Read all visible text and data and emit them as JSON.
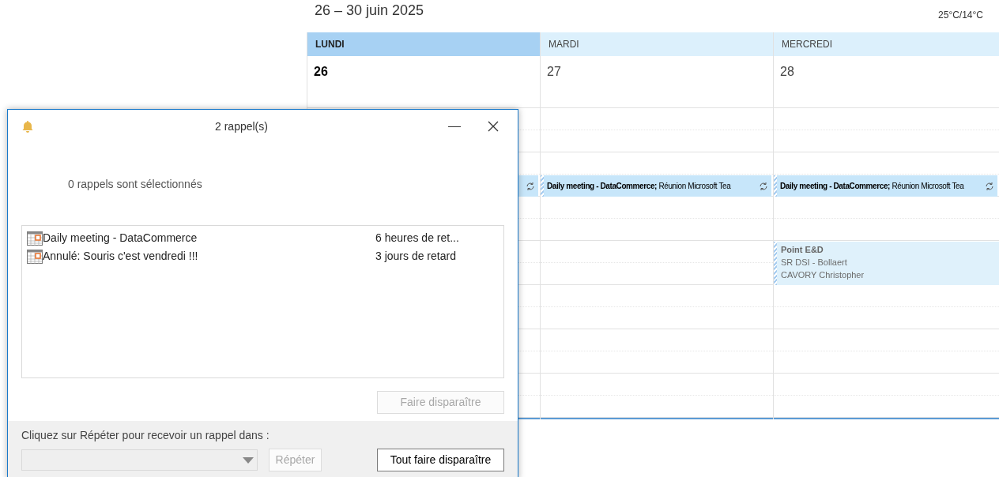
{
  "calendar": {
    "date_range": "26 – 30 juin 2025",
    "weather": "25°C/14°C",
    "days": [
      {
        "name": "LUNDI",
        "date": "26",
        "selected": true,
        "events": [
          {
            "kind": "covered"
          }
        ]
      },
      {
        "name": "MARDI",
        "date": "27",
        "selected": false,
        "events": [
          {
            "kind": "daily",
            "title": "Daily meeting - DataCommerce;",
            "detail": "Réunion Microsoft Tea"
          }
        ]
      },
      {
        "name": "MERCREDI",
        "date": "28",
        "selected": false,
        "events": [
          {
            "kind": "daily",
            "title": "Daily meeting - DataCommerce;",
            "detail": "Réunion Microsoft Tea"
          },
          {
            "kind": "meeting",
            "title": "Point E&D",
            "lines": [
              "SR DSI - Bollaert",
              "CAVORY Christopher"
            ]
          }
        ]
      }
    ]
  },
  "reminder_dialog": {
    "title": "2 rappel(s)",
    "selection_text": "0 rappels sont sélectionnés",
    "reminders": [
      {
        "subject": "Daily meeting - DataCommerce",
        "due": "6 heures de ret..."
      },
      {
        "subject": "Annulé: Souris c'est vendredi !!!",
        "due": "3 jours de retard"
      }
    ],
    "dismiss_button": {
      "label": "Faire disparaître",
      "disabled": true
    },
    "snooze_prompt": "Cliquez sur Répéter pour recevoir un rappel dans :",
    "snooze_select": {
      "disabled": true
    },
    "snooze_button": {
      "label": "Répéter",
      "disabled": true
    },
    "dismiss_all_button": {
      "label": "Tout faire disparaître",
      "disabled": false
    }
  }
}
